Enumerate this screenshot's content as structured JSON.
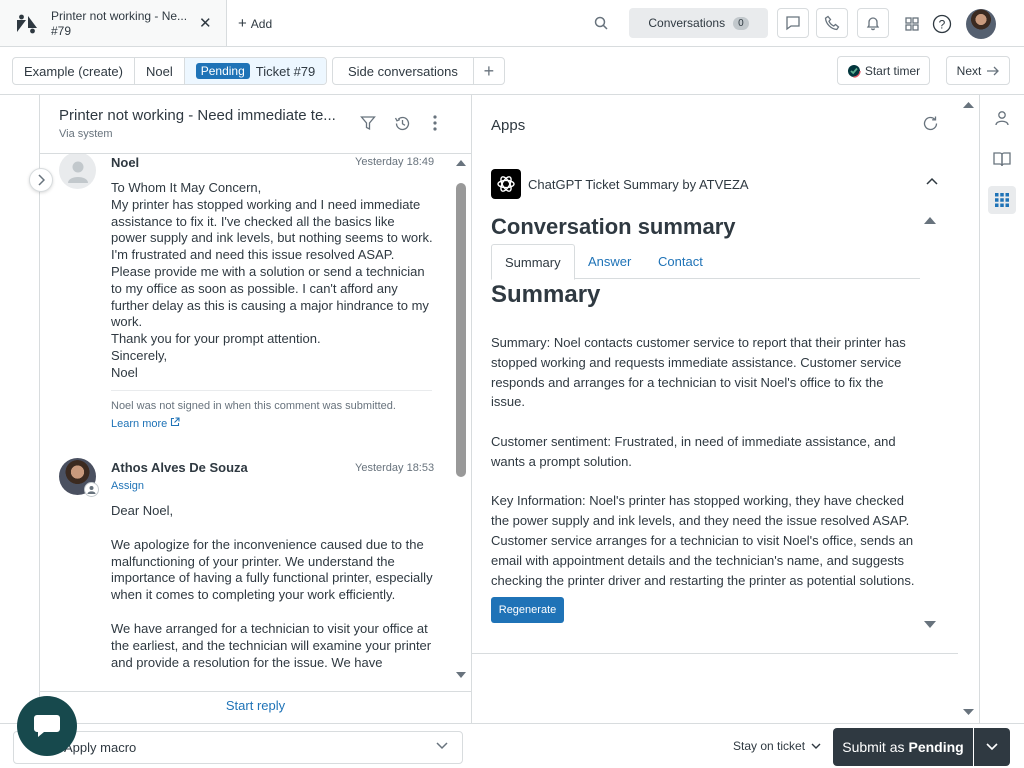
{
  "topbar": {
    "tab_title": "Printer not working - Ne...",
    "tab_subtitle": "#79",
    "add_label": "Add",
    "conversations_label": "Conversations",
    "conversations_count": "0"
  },
  "breadcrumb": {
    "item1": "Example (create)",
    "item2": "Noel",
    "status_badge": "Pending",
    "ticket_label": "Ticket #79"
  },
  "side_conversations_label": "Side conversations",
  "start_timer_label": "Start timer",
  "next_label": "Next",
  "ticket": {
    "title": "Printer not working - Need immediate te...",
    "via": "Via system"
  },
  "messages": [
    {
      "author": "Noel",
      "time": "Yesterday 18:49",
      "lines": [
        "To Whom It May Concern,",
        "My printer has stopped working and I need immediate assistance to fix it. I've checked all the basics like power supply and ink levels, but nothing seems to work. I'm frustrated and need this issue resolved ASAP.",
        "Please provide me with a solution or send a technician to my office as soon as possible. I can't afford any further delay as this is causing a major hindrance to my work.",
        "Thank you for your prompt attention.",
        "Sincerely,",
        "Noel"
      ],
      "note": "Noel was not signed in when this comment was submitted.",
      "learn_more": "Learn more"
    },
    {
      "author": "Athos Alves De Souza",
      "time": "Yesterday 18:53",
      "assign": "Assign",
      "paragraphs": [
        "Dear Noel,",
        "We apologize for the inconvenience caused due to the malfunctioning of your printer. We understand the importance of having a fully functional printer, especially when it comes to completing your work efficiently.",
        "We have arranged for a technician to visit your office at the earliest, and the technician will examine your printer and provide a resolution for the issue. We have"
      ]
    }
  ],
  "start_reply": "Start reply",
  "apps": {
    "title": "Apps",
    "app_name": "ChatGPT Ticket Summary by ATVEZA",
    "heading": "Conversation summary",
    "tabs": [
      "Summary",
      "Answer",
      "Contact"
    ],
    "section_title": "Summary",
    "summary": "Summary: Noel contacts customer service to report that their printer has stopped working and requests immediate assistance. Customer service responds and arranges for a technician to visit Noel's office to fix the issue.",
    "sentiment": "Customer sentiment: Frustrated, in need of immediate assistance, and wants a prompt solution.",
    "key_info": "Key Information: Noel's printer has stopped working, they have checked the power supply and ink levels, and they need the issue resolved ASAP. Customer service arranges for a technician to visit Noel's office, sends an email with appointment details and the technician's name, and suggests checking the printer driver and restarting the printer as potential solutions.",
    "regenerate": "Regenerate"
  },
  "bottom": {
    "macro_label": "Apply macro",
    "stay_label": "Stay on ticket",
    "submit_prefix": "Submit as",
    "submit_status": "Pending"
  },
  "colors": {
    "accent": "#1f73b7",
    "dark": "#2f3941",
    "chat_bubble": "#17494d"
  }
}
